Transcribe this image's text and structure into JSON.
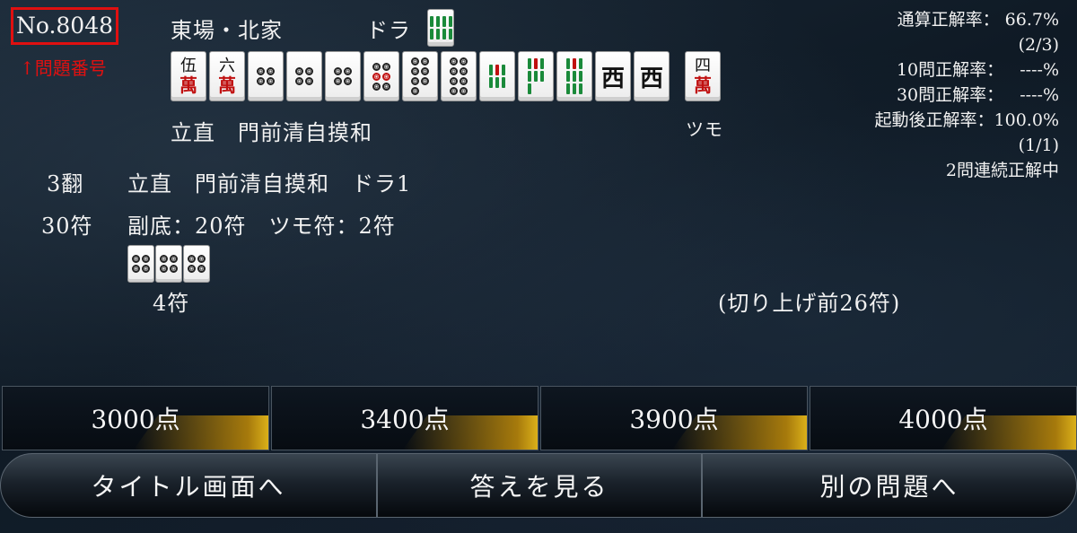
{
  "problem": {
    "number": "No.8048",
    "label": "↑問題番号"
  },
  "round": {
    "seat": "東場・北家",
    "dora_label": "ドラ",
    "dora_tile": "8-sou"
  },
  "hand": {
    "tiles": [
      {
        "type": "man",
        "top": "伍",
        "bottom": "萬"
      },
      {
        "type": "man",
        "top": "六",
        "bottom": "萬"
      },
      {
        "type": "pin",
        "count": 4
      },
      {
        "type": "pin",
        "count": 4
      },
      {
        "type": "pin",
        "count": 4
      },
      {
        "type": "pin",
        "count": 6,
        "red": true
      },
      {
        "type": "pin",
        "count": 7
      },
      {
        "type": "pin",
        "count": 8
      },
      {
        "type": "sou",
        "count": 6
      },
      {
        "type": "sou",
        "count": 7
      },
      {
        "type": "sou",
        "count": 9
      },
      {
        "type": "honor",
        "char": "西"
      },
      {
        "type": "honor",
        "char": "西"
      }
    ],
    "winning_tile": {
      "type": "man",
      "top": "四",
      "bottom": "萬"
    },
    "yaku_text": "立直　門前清自摸和",
    "win_type": "ツモ"
  },
  "stats": {
    "total_label": "通算正解率：",
    "total_value": "66.7%",
    "total_fraction": "(2/3)",
    "last10_label": "10問正解率：",
    "last10_value": "----%",
    "last30_label": "30問正解率：",
    "last30_value": "----%",
    "session_label": "起動後正解率：",
    "session_value": "100.0%",
    "session_fraction": "(1/1)",
    "streak": "2問連続正解中"
  },
  "scoring": {
    "han": "3翻",
    "yaku_list": "立直　門前清自摸和　ドラ1",
    "fu": "30符",
    "fu_breakdown": "副底：20符　ツモ符：2符",
    "meld_fu": "4符",
    "before_round": "(切り上げ前26符)"
  },
  "answers": [
    "3000点",
    "3400点",
    "3900点",
    "4000点"
  ],
  "nav": {
    "title": "タイトル画面へ",
    "show_answer": "答えを見る",
    "next": "別の問題へ"
  }
}
